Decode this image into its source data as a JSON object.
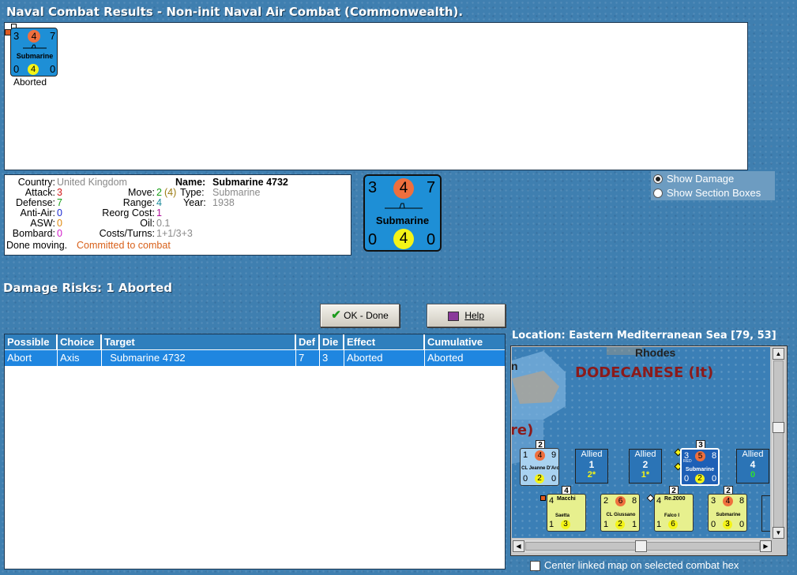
{
  "window": {
    "title": "Naval Combat Results - Non-init Naval Air Combat (Commonwealth)."
  },
  "results": {
    "counter": {
      "attack": "3",
      "move": "4",
      "defense": "7",
      "name": "Submarine",
      "aa": "0",
      "range": "4",
      "asw": "0"
    },
    "status": "Aborted"
  },
  "unit_info": {
    "country_label": "Country:",
    "country": "United Kingdom",
    "attack_label": "Attack:",
    "attack": "3",
    "defense_label": "Defense:",
    "defense": "7",
    "antiair_label": "Anti-Air:",
    "antiair": "0",
    "asw_label": "ASW:",
    "asw": "0",
    "bombard_label": "Bombard:",
    "bombard": "0",
    "name_label": "Name:",
    "name": "Submarine 4732",
    "move_label": "Move:",
    "move": "2",
    "move_extra": "(4)",
    "type_label": "Type:",
    "type": "Submarine",
    "range_label": "Range:",
    "range": "4",
    "year_label": "Year:",
    "year": "1938",
    "reorg_label": "Reorg Cost:",
    "reorg": "1",
    "oil_label": "Oil:",
    "oil": "0.1",
    "cost_label": "Costs/Turns:",
    "cost": "1+1/3+3",
    "status_text": "Done moving.",
    "status_combat": "Committed to combat"
  },
  "big_counter": {
    "attack": "3",
    "move": "4",
    "defense": "7",
    "name": "Submarine",
    "aa": "0",
    "range": "4",
    "asw": "0"
  },
  "options": {
    "show_damage": "Show Damage",
    "show_sections": "Show Section Boxes"
  },
  "damage_risks": "Damage Risks:  1 Aborted",
  "buttons": {
    "ok": "OK - Done",
    "help": "Help"
  },
  "table": {
    "headers": [
      "Possible",
      "Choice",
      "Target",
      "Def",
      "Die",
      "Effect",
      "Cumulative"
    ],
    "rows": [
      [
        "Abort",
        "Axis",
        "  Submarine 4732",
        "7",
        "3",
        "Aborted",
        "Aborted"
      ]
    ]
  },
  "location": "Location:  Eastern Mediterranean Sea [79, 53]",
  "map": {
    "region_label": "DODECANESE (It)",
    "town_label": "Rhodes",
    "edge_left": "n",
    "edge_left2": "re)",
    "allied_slots": [
      {
        "label": "Allied",
        "num": "1",
        "sub": "2*"
      },
      {
        "label": "Allied",
        "num": "2",
        "sub": "1*"
      },
      {
        "label": "Allied",
        "num": "4",
        "sub": "0"
      }
    ],
    "allied_units": [
      {
        "tag": "2",
        "a": "1",
        "m": "4",
        "d": "9",
        "name": "CL Jeanne D'Arc",
        "x": "0",
        "r": "2",
        "y": "0"
      },
      {
        "tag": "3",
        "a": "3",
        "m": "5",
        "d": "8",
        "name": "Submarine",
        "x": "0",
        "r": "2",
        "y": "0",
        "top": "RED"
      }
    ],
    "axis_units": [
      {
        "tag": "4",
        "a": "4",
        "m": "Macchi",
        "d": "",
        "name": "Saetta",
        "x": "1",
        "r": "3",
        "y": ""
      },
      {
        "tag": "",
        "a": "2",
        "m": "6",
        "d": "8",
        "name": "CL Giussano",
        "x": "1",
        "r": "2",
        "y": "1"
      },
      {
        "tag": "2",
        "a": "4",
        "m": "Re.2000",
        "d": "",
        "name": "Falco I",
        "x": "1",
        "r": "6",
        "y": ""
      },
      {
        "tag": "2",
        "a": "3",
        "m": "4",
        "d": "8",
        "name": "Submarine",
        "x": "0",
        "r": "3",
        "y": "0"
      }
    ]
  },
  "center_map_label": "Center linked map on selected combat hex",
  "colors": {
    "ocean": "#3f7fb0",
    "header_blue": "#2f7fbd",
    "selected_row": "#1f86e0",
    "counter_blue": "#1e8fd6",
    "axis_counter": "#e7f08e",
    "move_circle": "#ef6f3e",
    "range_circle": "#f4f417",
    "region_red": "#8b1a1a"
  }
}
